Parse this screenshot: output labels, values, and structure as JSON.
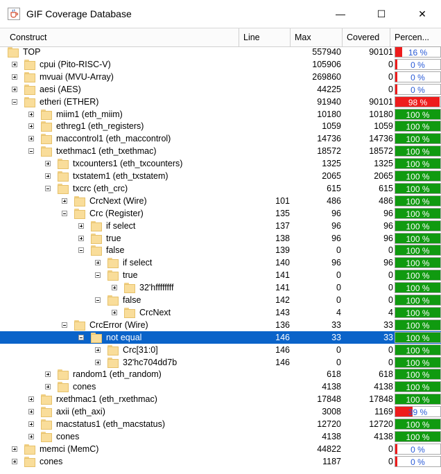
{
  "window": {
    "title": "GIF Coverage Database",
    "minimize_glyph": "—",
    "maximize_glyph": "☐",
    "close_glyph": "✕",
    "app_icon": "java-cup-icon"
  },
  "columns": {
    "construct": "Construct",
    "line": "Line",
    "max": "Max",
    "covered": "Covered",
    "percent": "Percen..."
  },
  "colors": {
    "full": "#109a10",
    "partial": "#ee1c1c",
    "selected": "#0a63c9",
    "pct_text_full": "#ffffff",
    "pct_text_low": "#2a5bd7"
  },
  "rows": [
    {
      "label": "TOP",
      "line": "",
      "max": "557940",
      "covered": "90101",
      "percent": "16 %",
      "pct": 16,
      "depth": 0,
      "expander": "none"
    },
    {
      "label": "cpui (Pito-RISC-V)",
      "line": "",
      "max": "105906",
      "covered": "0",
      "percent": "0 %",
      "pct": 0,
      "depth": 1,
      "expander": "plus"
    },
    {
      "label": "mvuai (MVU-Array)",
      "line": "",
      "max": "269860",
      "covered": "0",
      "percent": "0 %",
      "pct": 0,
      "depth": 1,
      "expander": "plus"
    },
    {
      "label": "aesi (AES)",
      "line": "",
      "max": "44225",
      "covered": "0",
      "percent": "0 %",
      "pct": 0,
      "depth": 1,
      "expander": "plus"
    },
    {
      "label": "etheri (ETHER)",
      "line": "",
      "max": "91940",
      "covered": "90101",
      "percent": "98 %",
      "pct": 98,
      "depth": 1,
      "expander": "minus"
    },
    {
      "label": "miim1 (eth_miim)",
      "line": "",
      "max": "10180",
      "covered": "10180",
      "percent": "100 %",
      "pct": 100,
      "depth": 2,
      "expander": "plus"
    },
    {
      "label": "ethreg1 (eth_registers)",
      "line": "",
      "max": "1059",
      "covered": "1059",
      "percent": "100 %",
      "pct": 100,
      "depth": 2,
      "expander": "plus"
    },
    {
      "label": "maccontrol1 (eth_maccontrol)",
      "line": "",
      "max": "14736",
      "covered": "14736",
      "percent": "100 %",
      "pct": 100,
      "depth": 2,
      "expander": "plus"
    },
    {
      "label": "txethmac1 (eth_txethmac)",
      "line": "",
      "max": "18572",
      "covered": "18572",
      "percent": "100 %",
      "pct": 100,
      "depth": 2,
      "expander": "minus"
    },
    {
      "label": "txcounters1 (eth_txcounters)",
      "line": "",
      "max": "1325",
      "covered": "1325",
      "percent": "100 %",
      "pct": 100,
      "depth": 3,
      "expander": "plus"
    },
    {
      "label": "txstatem1 (eth_txstatem)",
      "line": "",
      "max": "2065",
      "covered": "2065",
      "percent": "100 %",
      "pct": 100,
      "depth": 3,
      "expander": "plus"
    },
    {
      "label": "txcrc (eth_crc)",
      "line": "",
      "max": "615",
      "covered": "615",
      "percent": "100 %",
      "pct": 100,
      "depth": 3,
      "expander": "minus"
    },
    {
      "label": "CrcNext (Wire)",
      "line": "101",
      "max": "486",
      "covered": "486",
      "percent": "100 %",
      "pct": 100,
      "depth": 4,
      "expander": "plus"
    },
    {
      "label": "Crc (Register)",
      "line": "135",
      "max": "96",
      "covered": "96",
      "percent": "100 %",
      "pct": 100,
      "depth": 4,
      "expander": "minus"
    },
    {
      "label": "if select",
      "line": "137",
      "max": "96",
      "covered": "96",
      "percent": "100 %",
      "pct": 100,
      "depth": 5,
      "expander": "plus"
    },
    {
      "label": "true",
      "line": "138",
      "max": "96",
      "covered": "96",
      "percent": "100 %",
      "pct": 100,
      "depth": 5,
      "expander": "plus"
    },
    {
      "label": "false",
      "line": "139",
      "max": "0",
      "covered": "0",
      "percent": "100 %",
      "pct": 100,
      "depth": 5,
      "expander": "minus"
    },
    {
      "label": "if select",
      "line": "140",
      "max": "96",
      "covered": "96",
      "percent": "100 %",
      "pct": 100,
      "depth": 6,
      "expander": "plus"
    },
    {
      "label": "true",
      "line": "141",
      "max": "0",
      "covered": "0",
      "percent": "100 %",
      "pct": 100,
      "depth": 6,
      "expander": "minus"
    },
    {
      "label": "32'hffffffff",
      "line": "141",
      "max": "0",
      "covered": "0",
      "percent": "100 %",
      "pct": 100,
      "depth": 7,
      "expander": "plus"
    },
    {
      "label": "false",
      "line": "142",
      "max": "0",
      "covered": "0",
      "percent": "100 %",
      "pct": 100,
      "depth": 6,
      "expander": "minus"
    },
    {
      "label": "CrcNext",
      "line": "143",
      "max": "4",
      "covered": "4",
      "percent": "100 %",
      "pct": 100,
      "depth": 7,
      "expander": "plus"
    },
    {
      "label": "CrcError (Wire)",
      "line": "136",
      "max": "33",
      "covered": "33",
      "percent": "100 %",
      "pct": 100,
      "depth": 4,
      "expander": "minus"
    },
    {
      "label": "not equal",
      "line": "146",
      "max": "33",
      "covered": "33",
      "percent": "100 %",
      "pct": 100,
      "depth": 5,
      "expander": "minus",
      "selected": true
    },
    {
      "label": "Crc[31:0]",
      "line": "146",
      "max": "0",
      "covered": "0",
      "percent": "100 %",
      "pct": 100,
      "depth": 6,
      "expander": "plus"
    },
    {
      "label": "32'hc704dd7b",
      "line": "146",
      "max": "0",
      "covered": "0",
      "percent": "100 %",
      "pct": 100,
      "depth": 6,
      "expander": "plus"
    },
    {
      "label": "random1 (eth_random)",
      "line": "",
      "max": "618",
      "covered": "618",
      "percent": "100 %",
      "pct": 100,
      "depth": 3,
      "expander": "plus"
    },
    {
      "label": "cones",
      "line": "",
      "max": "4138",
      "covered": "4138",
      "percent": "100 %",
      "pct": 100,
      "depth": 3,
      "expander": "plus"
    },
    {
      "label": "rxethmac1 (eth_rxethmac)",
      "line": "",
      "max": "17848",
      "covered": "17848",
      "percent": "100 %",
      "pct": 100,
      "depth": 2,
      "expander": "plus"
    },
    {
      "label": "axii (eth_axi)",
      "line": "",
      "max": "3008",
      "covered": "1169",
      "percent": "39 %",
      "pct": 39,
      "depth": 2,
      "expander": "plus"
    },
    {
      "label": "macstatus1 (eth_macstatus)",
      "line": "",
      "max": "12720",
      "covered": "12720",
      "percent": "100 %",
      "pct": 100,
      "depth": 2,
      "expander": "plus"
    },
    {
      "label": "cones",
      "line": "",
      "max": "4138",
      "covered": "4138",
      "percent": "100 %",
      "pct": 100,
      "depth": 2,
      "expander": "plus"
    },
    {
      "label": "memci (MemC)",
      "line": "",
      "max": "44822",
      "covered": "0",
      "percent": "0 %",
      "pct": 0,
      "depth": 1,
      "expander": "plus"
    },
    {
      "label": "cones",
      "line": "",
      "max": "1187",
      "covered": "0",
      "percent": "0 %",
      "pct": 0,
      "depth": 1,
      "expander": "plus"
    }
  ]
}
